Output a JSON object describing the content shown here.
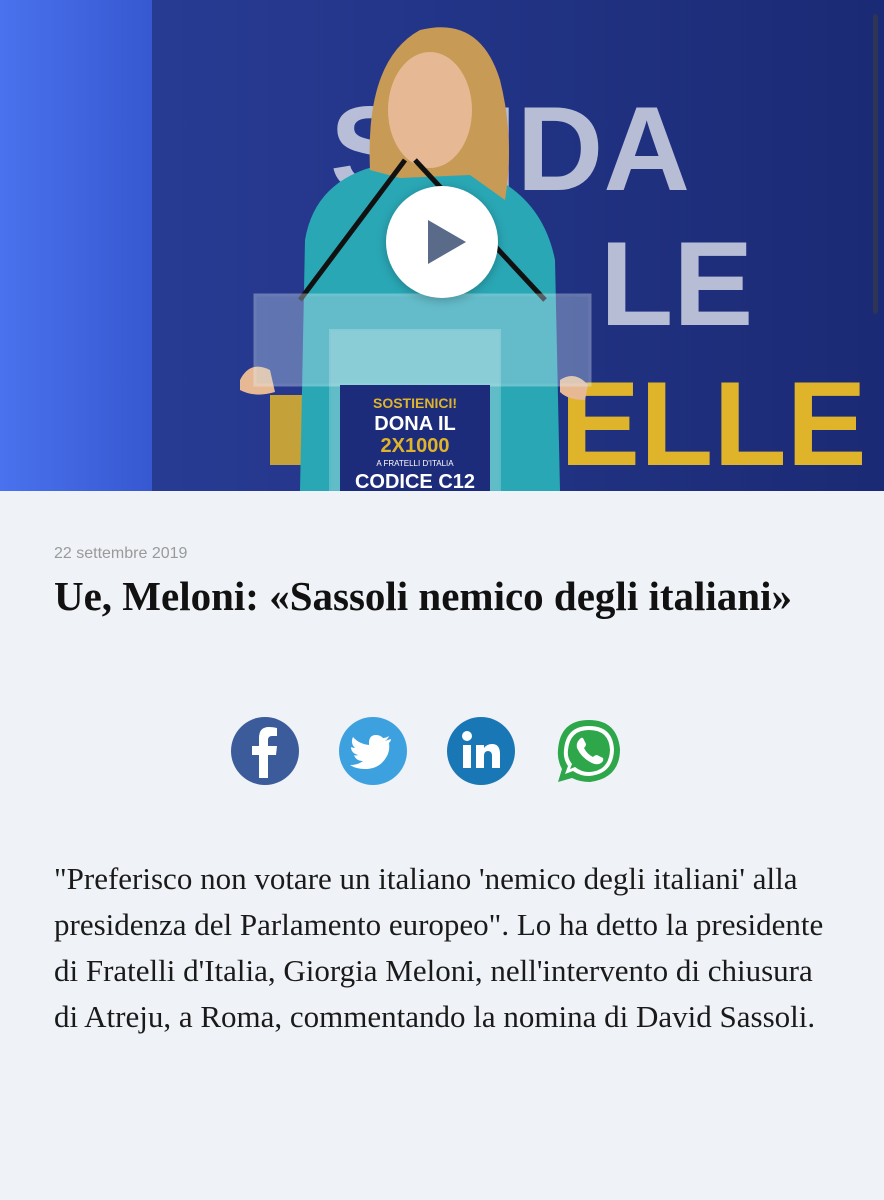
{
  "video": {
    "backdrop_text": [
      "SFIDA",
      "LE",
      "ELLE"
    ],
    "podium_text": [
      "SOSTIENICI!",
      "DONA IL",
      "2X1000",
      "A FRATELLI D'ITALIA",
      "CODICE C12"
    ],
    "colors": {
      "backdrop": "#1c2b7a",
      "side_panel": "#3a63e0",
      "gold": "#e0b42a",
      "jacket": "#2aa7b5"
    }
  },
  "article": {
    "date": "22 settembre 2019",
    "title": "Ue, Meloni: «Sassoli nemico degli italiani»",
    "body": "\"Preferisco non votare un italiano 'nemico degli italiani' alla presidenza del Parlamento europeo\". Lo ha detto la presidente di Fratelli d'Italia, Giorgia Meloni, nell'intervento di chiusura di Atreju, a Roma, commentando la nomina di David Sassoli."
  },
  "share": [
    {
      "network": "facebook",
      "icon": "facebook-icon",
      "color": "#3b5b9a"
    },
    {
      "network": "twitter",
      "icon": "twitter-icon",
      "color": "#3da1e0"
    },
    {
      "network": "linkedin",
      "icon": "linkedin-icon",
      "color": "#1a77b5"
    },
    {
      "network": "whatsapp",
      "icon": "whatsapp-icon",
      "color": "#2ea64a"
    }
  ]
}
